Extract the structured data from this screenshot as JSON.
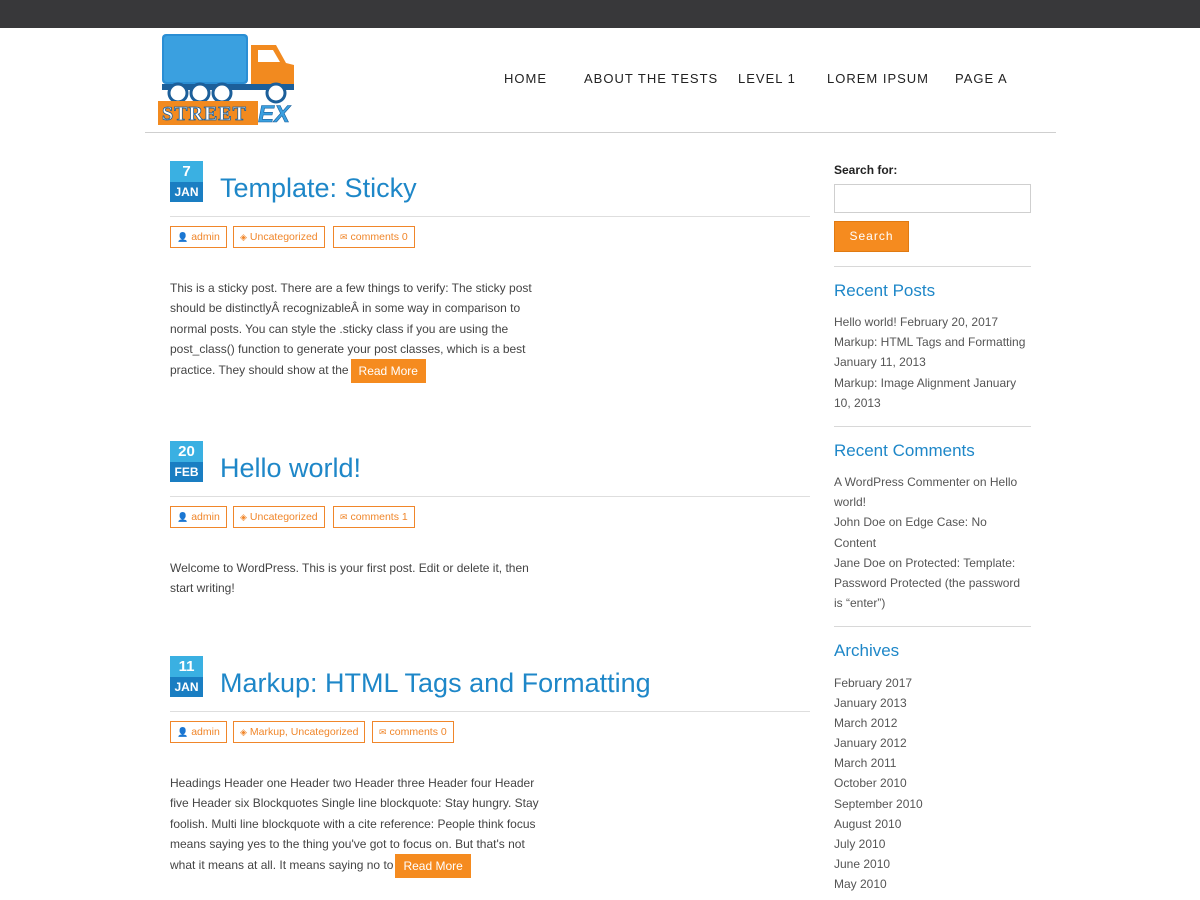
{
  "nav": {
    "items": [
      "HOME",
      "ABOUT THE TESTS",
      "LEVEL 1",
      "LOREM IPSUM",
      "PAGE A"
    ]
  },
  "logo": {
    "text": "STREETEX"
  },
  "posts": [
    {
      "day": "7",
      "month": "JAN",
      "title": "Template: Sticky",
      "author": "admin",
      "categories": "Uncategorized",
      "comments": "comments 0",
      "excerpt": "This is a sticky post. There are a few things to verify: The sticky post should be distinctlyÂ recognizableÂ in some way in comparison to normal posts. You can style the .sticky class if you are using the post_class() function to generate your post classes, which is a best practice. They should show at the",
      "read_more": "Read More"
    },
    {
      "day": "20",
      "month": "FEB",
      "title": "Hello world!",
      "author": "admin",
      "categories": "Uncategorized",
      "comments": "comments 1",
      "excerpt": "Welcome to WordPress. This is your first post. Edit or delete it, then start writing!"
    },
    {
      "day": "11",
      "month": "JAN",
      "title": "Markup: HTML Tags and Formatting",
      "author": "admin",
      "categories": "Markup, Uncategorized",
      "comments": "comments 0",
      "excerpt": "Headings Header one Header two Header three Header four Header five Header six Blockquotes Single line blockquote: Stay hungry. Stay foolish. Multi line blockquote with a cite reference: People think focus means saying yes to the thing you've got to focus on. But that's not what it means at all. It means saying no to",
      "read_more": "Read More"
    }
  ],
  "sidebar": {
    "search_label": "Search for:",
    "search_value": "",
    "search_button": "Search",
    "recent_posts_title": "Recent Posts",
    "recent_posts": [
      {
        "title": "Hello world!",
        "date": "February 20, 2017"
      },
      {
        "title": "Markup: HTML Tags and Formatting",
        "date": "January 11, 2013"
      },
      {
        "title": "Markup: Image Alignment",
        "date": "January 10, 2013"
      }
    ],
    "recent_comments_title": "Recent Comments",
    "recent_comments": [
      {
        "author": "A WordPress Commenter",
        "on": "on",
        "post": "Hello world!"
      },
      {
        "author": "John Doe",
        "on": "on",
        "post": "Edge Case: No Content"
      },
      {
        "author": "Jane Doe",
        "on": "on",
        "post": "Protected: Template: Password Protected (the password is “enter”)"
      }
    ],
    "archives_title": "Archives",
    "archives": [
      "February 2017",
      "January 2013",
      "March 2012",
      "January 2012",
      "March 2011",
      "October 2010",
      "September 2010",
      "August 2010",
      "July 2010",
      "June 2010",
      "May 2010"
    ]
  },
  "colors": {
    "topbar": "#38383a",
    "accent_orange": "#f58b1f",
    "title_blue": "#1e87c8",
    "date_day_blue": "#3ab0e2",
    "date_month_blue": "#1a7ec2"
  }
}
